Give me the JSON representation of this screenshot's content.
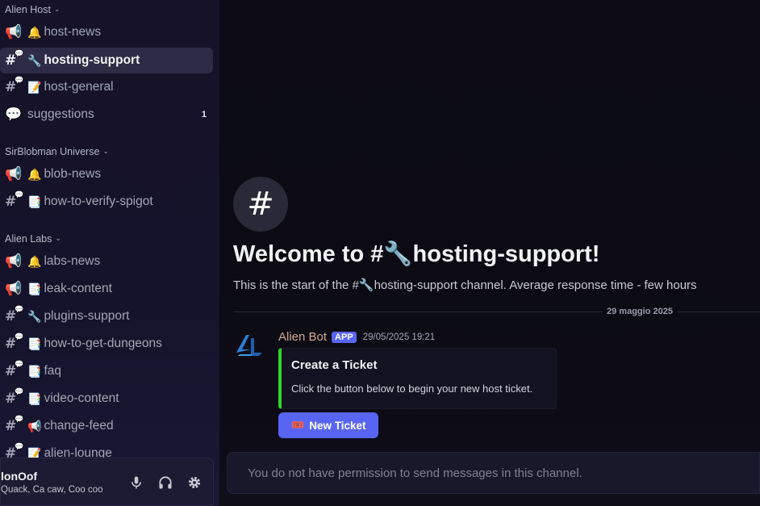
{
  "sidebar": {
    "categories": [
      {
        "label": "Alien Host"
      },
      {
        "label": "SirBlobman Universe"
      },
      {
        "label": "Alien Labs"
      }
    ],
    "channels": [
      {
        "type": "announcement",
        "emoji": "🔔",
        "label": "host-news"
      },
      {
        "type": "text",
        "emoji": "🔧",
        "label": "hosting-support",
        "active": true
      },
      {
        "type": "text",
        "emoji": "📝",
        "label": "host-general"
      },
      {
        "type": "forum",
        "emoji": "",
        "label": "suggestions",
        "badge": "1"
      },
      {
        "type": "announcement",
        "emoji": "🔔",
        "label": "blob-news"
      },
      {
        "type": "text",
        "emoji": "📑",
        "label": "how-to-verify-spigot"
      },
      {
        "type": "announcement",
        "emoji": "🔔",
        "label": "labs-news"
      },
      {
        "type": "announcement",
        "emoji": "📑",
        "label": "leak-content"
      },
      {
        "type": "text",
        "emoji": "🔧",
        "label": "plugins-support"
      },
      {
        "type": "text",
        "emoji": "📑",
        "label": "how-to-get-dungeons"
      },
      {
        "type": "text",
        "emoji": "📑",
        "label": "faq"
      },
      {
        "type": "text",
        "emoji": "📑",
        "label": "video-content"
      },
      {
        "type": "text",
        "emoji": "📢",
        "label": "change-feed"
      },
      {
        "type": "text",
        "emoji": "📝",
        "label": "alien-lounge"
      }
    ]
  },
  "user": {
    "name": "lonOof",
    "status": "Quack, Ca caw, Coo coo",
    "controls": [
      "microphone-icon",
      "headphones-icon",
      "gear-icon"
    ]
  },
  "channel_header": {
    "icon": "#",
    "title": "Welcome to #🔧hosting-support!",
    "subtitle": "This is the start of the #🔧hosting-support channel. Average response time - few hours"
  },
  "date_divider": "29 maggio 2025",
  "message": {
    "author": "Alien Bot",
    "tag": "APP",
    "timestamp": "29/05/2025 19:21",
    "embed": {
      "title": "Create a Ticket",
      "description": "Click the button below to begin your new host ticket.",
      "accent": "#2bd92b"
    },
    "button": {
      "emoji": "🎟️",
      "label": "New Ticket"
    }
  },
  "composer": {
    "placeholder": "You do not have permission to send messages in this channel."
  },
  "colors": {
    "accent": "#5865f2",
    "sidebar_bg": "#15122a",
    "main_bg": "#0c0b14",
    "author_name": "#d4a98a"
  }
}
